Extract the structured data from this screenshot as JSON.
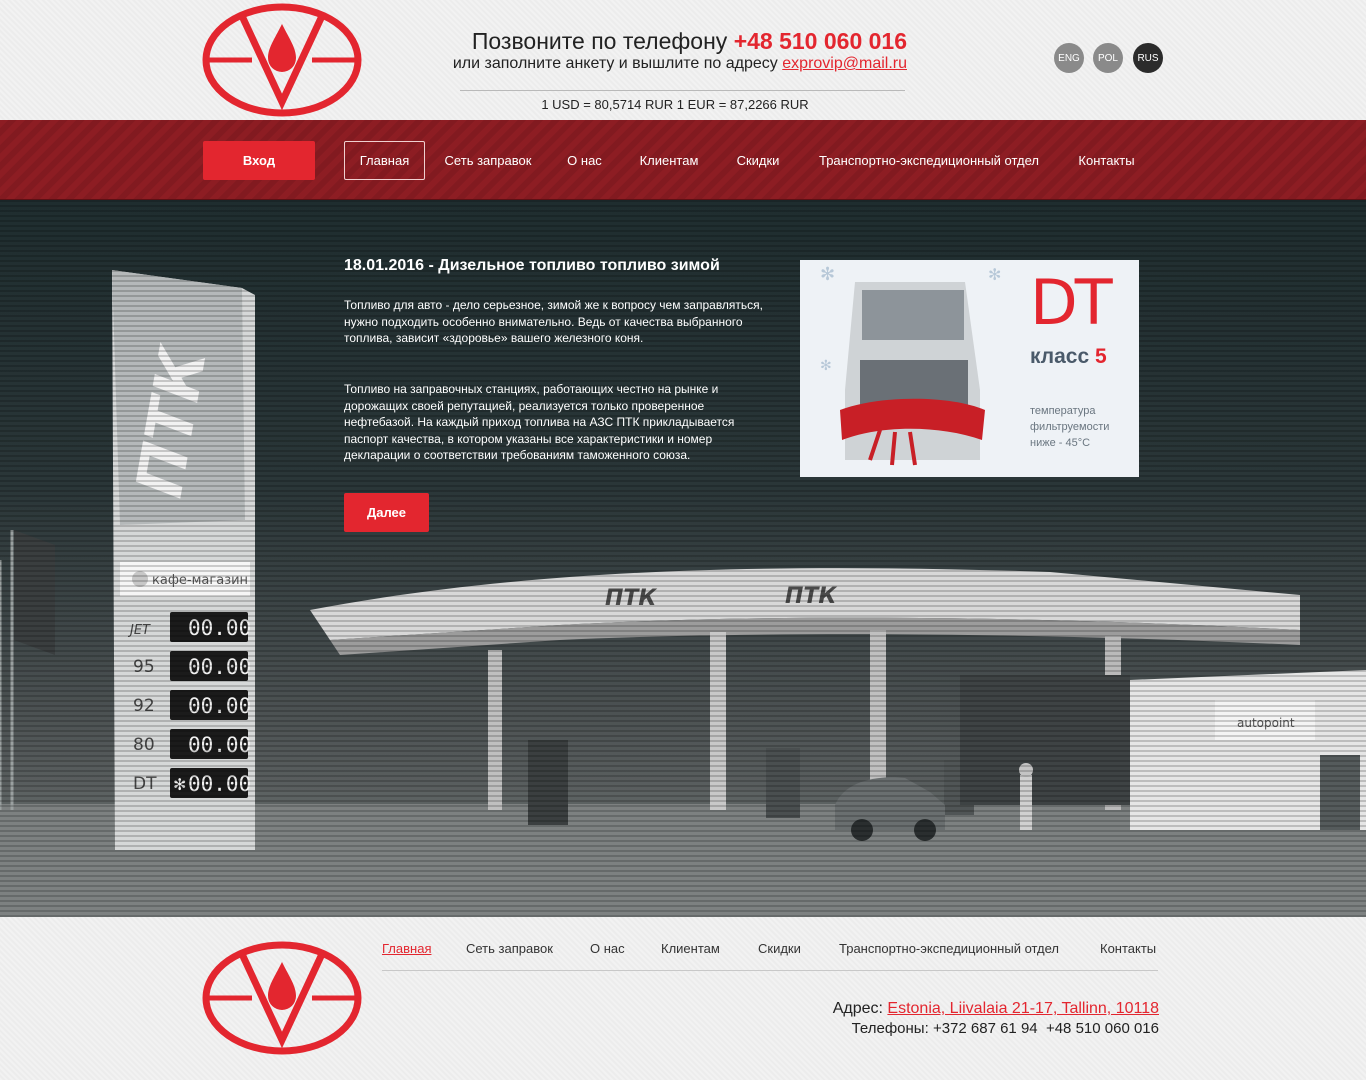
{
  "header": {
    "phone_prefix": "Позвоните по телефону",
    "phone": "+48 510 060 016",
    "mail_prefix": "или заполните анкету и вышлите по адресу",
    "email": "exprovip@mail.ru",
    "rates": "1 USD = 80,5714 RUR 1 EUR = 87,2266 RUR",
    "languages": [
      {
        "label": "ENG",
        "color": "#8a8a8a"
      },
      {
        "label": "POL",
        "color": "#8a8a8a"
      },
      {
        "label": "RUS",
        "color": "#2b2b2b"
      }
    ]
  },
  "nav": {
    "login": "Вход",
    "items": [
      {
        "label": "Главная",
        "active": true
      },
      {
        "label": "Сеть заправок"
      },
      {
        "label": "О нас"
      },
      {
        "label": "Клиентам"
      },
      {
        "label": "Скидки"
      },
      {
        "label": "Транспортно-экспедиционный отдел"
      },
      {
        "label": "Контакты"
      }
    ]
  },
  "news": {
    "title": "18.01.2016 - Дизельное топливо топливо зимой",
    "paragraphs": [
      "Топливо для авто - дело серьезное, зимой же к вопросу чем заправляться, нужно подходить особенно внимательно. Ведь от качества выбранного топлива, зависит «здоровье» вашего железного коня.",
      "Топливо на заправочных станциях, работающих честно на рынке и дорожащих своей репутацией, реализуется только проверенное нефтебазой. На каждый приход топлива на АЗС ПТК прикладывается паспорт качества, в котором указаны все характеристики и номер декларации о соответствии требованиям таможенного союза."
    ],
    "more": "Далее"
  },
  "promo": {
    "dt": "DT",
    "class_label": "класс",
    "class_number": "5",
    "note": "температура фильтруемости ниже - 45°C"
  },
  "scene": {
    "pylon_brand": "ПТК",
    "cafe": "кафе-магазин",
    "canopy_brand": "ПТК",
    "shop_sign": "autopoint",
    "prices": [
      {
        "grade": "JET",
        "value": "00.00"
      },
      {
        "grade": "95",
        "value": "00.00"
      },
      {
        "grade": "92",
        "value": "00.00"
      },
      {
        "grade": "80",
        "value": "00.00"
      },
      {
        "grade": "DT",
        "value": "00.00",
        "snow": "✻"
      }
    ]
  },
  "footer": {
    "nav": [
      {
        "label": "Главная",
        "active": true
      },
      {
        "label": "Сеть заправок"
      },
      {
        "label": "О нас"
      },
      {
        "label": "Клиентам"
      },
      {
        "label": "Скидки"
      },
      {
        "label": "Транспортно-экспедиционный отдел"
      },
      {
        "label": "Контакты"
      }
    ],
    "address_label": "Адрес:",
    "address": "Estonia, Liivalaia 21-17, Tallinn, 10118",
    "phones_label": "Телефоны:",
    "phones": "+372 687 61 94  +48 510 060 016"
  },
  "colors": {
    "accent": "#e3262f",
    "nav_bg": "#8d1d23",
    "hero_dark": "#1f2d2f"
  }
}
